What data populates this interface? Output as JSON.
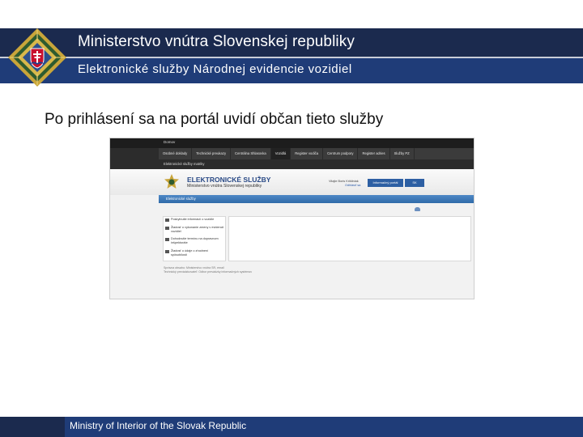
{
  "slide": {
    "title": "Ministerstvo vnútra Slovenskej republiky",
    "subtitle": "Elektronické služby Národnej evidencie vozidiel",
    "heading": "Po prihlásení sa na portál uvidí občan tieto služby",
    "footer": "Ministry of Interior of the Slovak Republic"
  },
  "colors": {
    "header_dark": "#1b2a4e",
    "header_blue": "#1f3c78",
    "emblem_gold": "#c9a53a",
    "emblem_green": "#2f5b2f",
    "accent_blue": "#2d5fa3"
  },
  "icons": {
    "emblem": "ministry-emblem-icon",
    "portal_logo": "police-star-icon",
    "help": "help-icon",
    "menu_bullet": "document-icon"
  },
  "screenshot": {
    "topbar_label": "Domov",
    "nav": [
      "Osobné doklady",
      "Technické preukazy",
      "Centrálna Shlasovka",
      "Vozidlá",
      "Register vodiča",
      "Centrum podpory",
      "Register adries",
      "Služby PZ"
    ],
    "nav_active_index": 3,
    "subnav_label": "Elektronické služby matriky",
    "brand_title": "ELEKTRONICKÉ SLUŽBY",
    "brand_subtitle": "Ministerstvo vnútra Slovenskej republiky",
    "user_label": "Vitajte Boris Krištiniak",
    "logout_label": "Odhlásiť sa",
    "portal_button": "Informačný portál",
    "lang_button": "SK",
    "section_label": "Elektronické služby",
    "services": [
      "Poskytnutie informácií o vozidle",
      "Žiadosť o vykonanie zmeny v evidencii vozidiel",
      "Dohodnutie termínu na dopravnom inšpektoráte",
      "Žiadosť o údaje o zhodnení spôsobilosti"
    ],
    "footer_line1": "Správca obsahu: Ministerstvo vnútra SR, email",
    "footer_line2": "Technický prevádzkovateľ: Odbor prevádzky informačných systémov"
  }
}
